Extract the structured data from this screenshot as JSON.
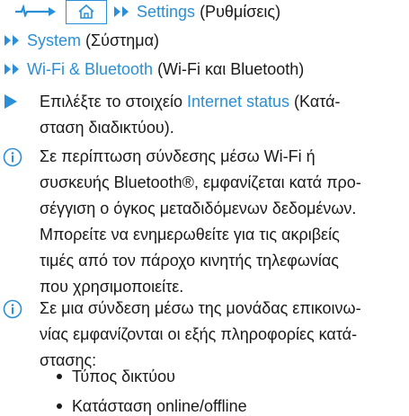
{
  "breadcrumb": {
    "settings_label": "Settings",
    "settings_translation": "(Ρυθμίσεις)",
    "system_label": "System",
    "system_translation": "(Σύστημα)",
    "wifi_label": "Wi-Fi & Bluetooth",
    "wifi_translation": "(Wi-Fi και Bluetooth)"
  },
  "step": {
    "line1_prefix": "Επιλέξτε το στοιχείο ",
    "line1_link": "Internet status",
    "line1_suffix": " (Κατά-",
    "line2": "σταση διαδικτύου)."
  },
  "note1": {
    "lines": [
      "Σε περίπτωση σύνδεσης μέσω Wi-Fi ή",
      "συσκευής Bluetooth®, εμφανίζεται κατά προ-",
      "σέγγιση ο όγκος μεταδιδόμενων δεδομένων.",
      "Μπορείτε να ενημερωθείτε για τις ακριβείς",
      "τιμές από τον πάροχο κινητής τηλεφωνίας",
      "που χρησιμοποιείτε."
    ]
  },
  "note2": {
    "lines": [
      "Σε μια σύνδεση μέσω της μονάδας επικοινω-",
      "νίας εμφανίζονται οι εξής πληροφορίες κατά-",
      "στασης:"
    ],
    "bullets": [
      "Τύπος δικτύου",
      "Κατάσταση online/offline"
    ]
  },
  "colors": {
    "accent": "#2a8fd6",
    "text": "#1a1a1a"
  },
  "icons": {
    "start": "arrow-right-icon",
    "home": "home-icon",
    "nav": "double-chevron-right-icon",
    "step": "play-triangle-icon",
    "info": "info-icon"
  }
}
